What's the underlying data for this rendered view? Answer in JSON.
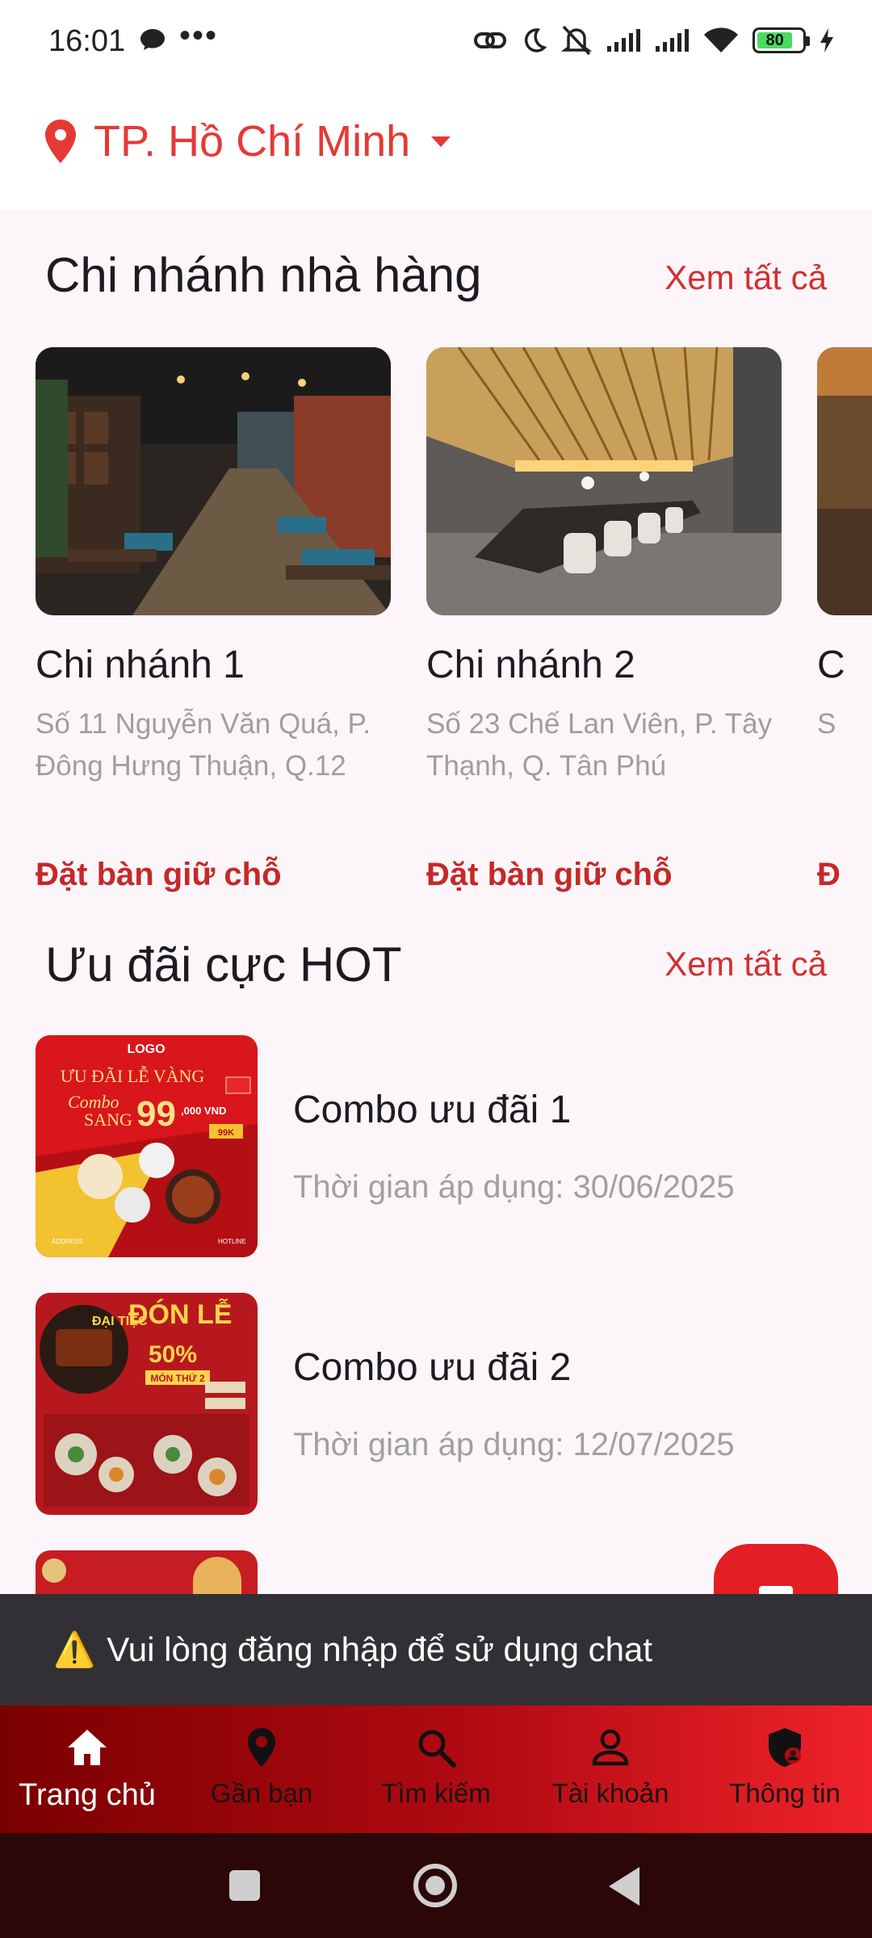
{
  "status_bar": {
    "time": "16:01",
    "dots": "•••",
    "battery_level": "80",
    "icons": [
      "messenger-icon",
      "link-icon",
      "moon-icon",
      "mute-icon",
      "signal-icon",
      "signal-icon",
      "wifi-icon",
      "battery-icon",
      "charging-icon"
    ]
  },
  "header": {
    "location": "TP. Hồ Chí Minh"
  },
  "branches_section": {
    "title": "Chi nhánh nhà hàng",
    "see_all": "Xem tất cả",
    "items": [
      {
        "name": "Chi nhánh 1",
        "address": "Số 11 Nguyễn Văn Quá, P. Đông Hưng Thuận, Q.12",
        "book": "Đặt bàn giữ chỗ"
      },
      {
        "name": "Chi nhánh 2",
        "address": "Số 23 Chế Lan Viên, P. Tây Thạnh, Q. Tân Phú",
        "book": "Đặt bàn giữ chỗ"
      },
      {
        "name": "C",
        "address": "S",
        "book": "Đ"
      }
    ]
  },
  "promos_section": {
    "title": "Ưu đãi cực HOT",
    "see_all": "Xem tất cả",
    "items": [
      {
        "title": "Combo ưu đãi 1",
        "date": "Thời gian áp dụng: 30/06/2025",
        "poster": {
          "logo": "LOGO",
          "headline": "ƯU ĐÃI LỄ VÀNG",
          "combo": "Combo",
          "sang": "SANG",
          "price": "99",
          "price_suffix": ",000 VND",
          "badge": "99K",
          "footer_left": "ADDRESS",
          "footer_right": "HOTLINE"
        }
      },
      {
        "title": "Combo ưu đãi 2",
        "date": "Thời gian áp dụng: 12/07/2025",
        "poster": {
          "tag": "ĐẠI TIỆC",
          "headline": "ĐÓN LỄ",
          "discount": "50%",
          "sub": "MÓN THỨ 2"
        }
      }
    ]
  },
  "chat_fab": {
    "icon": "chat-icon"
  },
  "snackbar": {
    "icon": "⚠️",
    "text": "Vui lòng đăng nhập để sử dụng chat"
  },
  "bottom_nav": [
    {
      "label": "Trang chủ",
      "icon": "home-icon",
      "active": true
    },
    {
      "label": "Gần bạn",
      "icon": "location-pin-icon"
    },
    {
      "label": "Tìm kiếm",
      "icon": "search-icon"
    },
    {
      "label": "Tài khoản",
      "icon": "person-icon"
    },
    {
      "label": "Thông tin",
      "icon": "shield-account-icon"
    }
  ],
  "colors": {
    "accent": "#e53935",
    "book_text": "#c62828",
    "nav_gradient_start": "#7a0000",
    "nav_gradient_end": "#f0232a",
    "snackbar_bg": "#323034"
  }
}
